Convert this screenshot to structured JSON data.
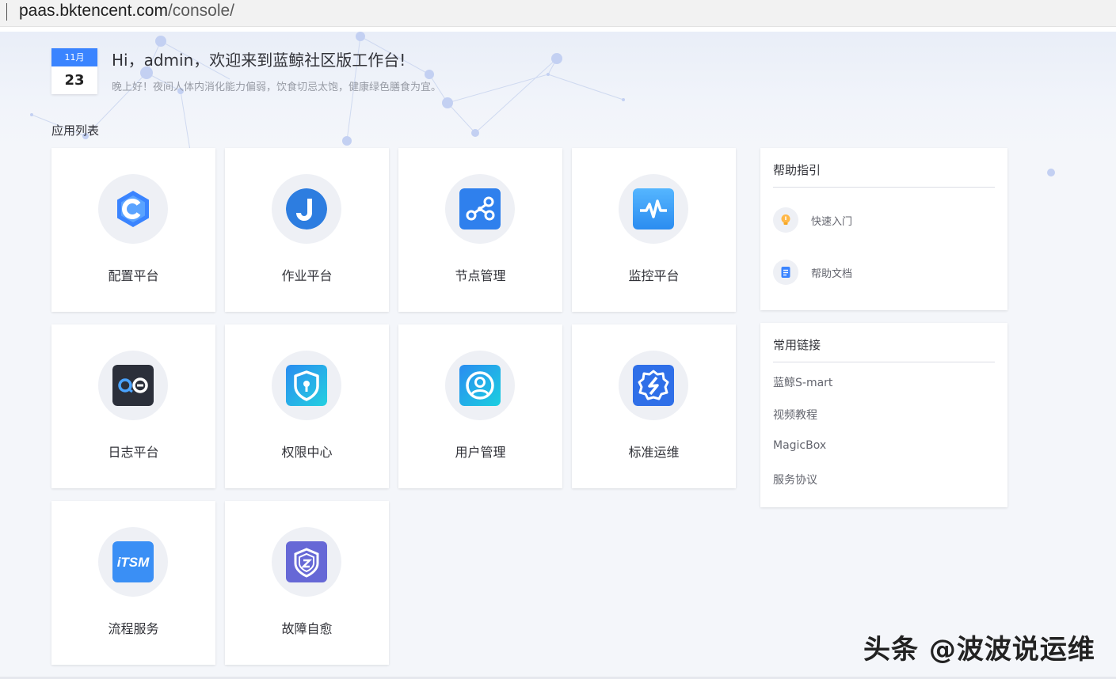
{
  "browser": {
    "url_host": "paas.bktencent.com",
    "url_path": "/console/"
  },
  "date": {
    "month": "11月",
    "day": "23"
  },
  "header": {
    "greeting": "Hi，admin，欢迎来到蓝鲸社区版工作台!",
    "subgreeting": "晚上好！夜间人体内消化能力偏弱，饮食切忌太饱，健康绿色膳食为宜。"
  },
  "apps": {
    "section_title": "应用列表",
    "items": [
      {
        "label": "配置平台",
        "icon": "cmdb-icon",
        "color": "#3a84ff"
      },
      {
        "label": "作业平台",
        "icon": "job-icon",
        "color": "#2d7de0"
      },
      {
        "label": "节点管理",
        "icon": "node-icon",
        "color": "#2f80ed"
      },
      {
        "label": "监控平台",
        "icon": "monitor-icon",
        "color": "#3aa0ff"
      },
      {
        "label": "日志平台",
        "icon": "log-icon",
        "color": "#2b2f3a"
      },
      {
        "label": "权限中心",
        "icon": "iam-icon",
        "color": "#1ec0e0"
      },
      {
        "label": "用户管理",
        "icon": "usermgr-icon",
        "color": "#19b6e8"
      },
      {
        "label": "标准运维",
        "icon": "sops-icon",
        "color": "#2f6fe8"
      },
      {
        "label": "流程服务",
        "icon": "itsm-icon",
        "color": "#3a8ff5"
      },
      {
        "label": "故障自愈",
        "icon": "fta-icon",
        "color": "#6668d6"
      }
    ]
  },
  "help": {
    "title": "帮助指引",
    "items": [
      {
        "label": "快速入门",
        "icon": "lightbulb-icon"
      },
      {
        "label": "帮助文档",
        "icon": "document-icon"
      }
    ]
  },
  "links": {
    "title": "常用链接",
    "items": [
      "蓝鲸S-mart",
      "视频教程",
      "MagicBox",
      "服务协议"
    ]
  },
  "watermark": "头条 @波波说运维"
}
